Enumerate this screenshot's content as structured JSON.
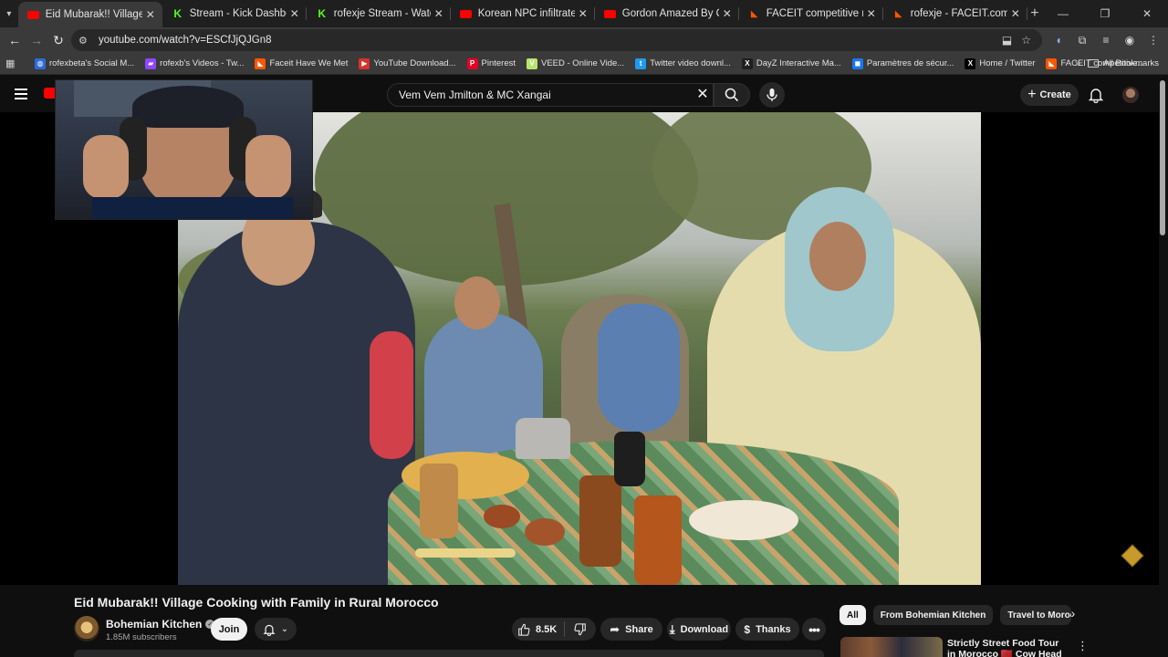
{
  "browser": {
    "tabs": [
      {
        "title": "Eid Mubarak!! Village Cooking w",
        "favicon": "youtube-icon",
        "active": true
      },
      {
        "title": "Stream - Kick Dashboard",
        "favicon": "kick-icon",
        "active": false
      },
      {
        "title": "rofexje Stream - Watch Live on",
        "favicon": "kick-icon",
        "active": false
      },
      {
        "title": "Korean NPC infiltrates Sony HQ",
        "favicon": "youtube-icon",
        "active": false
      },
      {
        "title": "Gordon Amazed By Chef Who M",
        "favicon": "youtube-icon",
        "active": false
      },
      {
        "title": "FACEIT competitive match - FAC",
        "favicon": "faceit-icon",
        "active": false
      },
      {
        "title": "rofexje - FACEIT.com",
        "favicon": "faceit-icon",
        "active": false
      }
    ],
    "url": "youtube.com/watch?v=ESCfJjQJGn8",
    "bookmarks": [
      {
        "label": "rofexbeta's Social M...",
        "icon": "social-icon",
        "color": "#2f6bd8"
      },
      {
        "label": "rofexb's Videos - Tw...",
        "icon": "twitch-icon",
        "color": "#9146ff"
      },
      {
        "label": "Faceit Have We Met",
        "icon": "faceit-icon",
        "color": "#ff5500"
      },
      {
        "label": "YouTube Download...",
        "icon": "download-icon",
        "color": "#d6322b"
      },
      {
        "label": "Pinterest",
        "icon": "pinterest-icon",
        "color": "#e60023"
      },
      {
        "label": "VEED - Online Vide...",
        "icon": "veed-icon",
        "color": "#b7e66b"
      },
      {
        "label": "Twitter video downl...",
        "icon": "twitter-icon",
        "color": "#1d9bf0"
      },
      {
        "label": "DayZ Interactive Ma...",
        "icon": "dayz-icon",
        "color": "#1f1f1f"
      },
      {
        "label": "Paramètres de sécur...",
        "icon": "settings-icon",
        "color": "#1877f2"
      },
      {
        "label": "Home / Twitter",
        "icon": "x-icon",
        "color": "#000000"
      },
      {
        "label": "FACEIT competitive...",
        "icon": "faceit-icon",
        "color": "#ff5500"
      }
    ],
    "all_bookmarks_label": "All Bookmarks"
  },
  "youtube": {
    "search_query": "Vem Vem Jmilton & MC Xangai",
    "create_label": "Create",
    "video": {
      "title": "Eid Mubarak!! Village Cooking with Family in Rural Morocco",
      "channel": "Bohemian Kitchen",
      "subscribers": "1.85M subscribers",
      "join_label": "Join",
      "likes": "8.5K",
      "share_label": "Share",
      "download_label": "Download",
      "thanks_label": "Thanks"
    },
    "chips": [
      "All",
      "From Bohemian Kitchen",
      "Travel to Morocco"
    ],
    "recommended": {
      "title": "Strictly Street Food Tour in Morocco 🇲🇦 Cow Head"
    }
  },
  "colors": {
    "background": "#0f0f0f",
    "youtube_red": "#ff0000",
    "chip_bg": "#272727",
    "browser_chrome": "#3a3a3a"
  }
}
